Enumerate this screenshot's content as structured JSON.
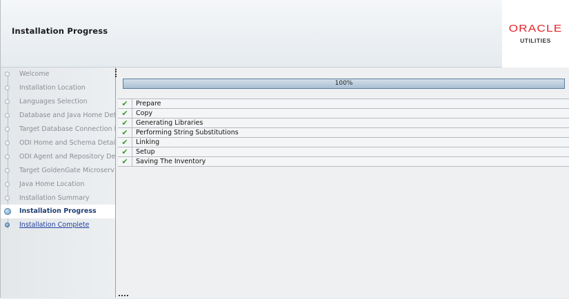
{
  "header": {
    "title": "Installation Progress",
    "logo_brand": "ORACLE",
    "logo_sub": "UTILITIES"
  },
  "sidebar": {
    "steps": [
      {
        "label": "Welcome",
        "state": "done"
      },
      {
        "label": "Installation Location",
        "state": "done"
      },
      {
        "label": "Languages Selection",
        "state": "done"
      },
      {
        "label": "Database and Java Home Det",
        "state": "done"
      },
      {
        "label": "Target Database Connection I",
        "state": "done"
      },
      {
        "label": "ODI Home and Schema Detail",
        "state": "done"
      },
      {
        "label": "ODI Agent and Repository Det",
        "state": "done"
      },
      {
        "label": "Target GoldenGate Microserv",
        "state": "done"
      },
      {
        "label": "Java Home Location",
        "state": "done"
      },
      {
        "label": "Installation Summary",
        "state": "done"
      },
      {
        "label": "Installation Progress",
        "state": "current"
      },
      {
        "label": "Installation Complete",
        "state": "future"
      }
    ]
  },
  "progress": {
    "value": 100,
    "label": "100%"
  },
  "tasks": [
    {
      "label": "Prepare",
      "status": "complete",
      "check": "✔"
    },
    {
      "label": "Copy",
      "status": "complete",
      "check": "✔"
    },
    {
      "label": "Generating Libraries",
      "status": "complete",
      "check": "✔"
    },
    {
      "label": "Performing String Substitutions",
      "status": "complete",
      "check": "✔"
    },
    {
      "label": "Linking",
      "status": "complete",
      "check": "✔"
    },
    {
      "label": "Setup",
      "status": "complete",
      "check": "✔"
    },
    {
      "label": "Saving The Inventory",
      "status": "complete",
      "check": "✔"
    }
  ],
  "colors": {
    "brand": "#e3262a",
    "check": "#3a9b2a",
    "current_step": "#1f3f73",
    "link_step": "#1f3f9f"
  },
  "icons": {
    "task_status": "checkmark-icon",
    "step_marker": "step-dot-icon"
  }
}
